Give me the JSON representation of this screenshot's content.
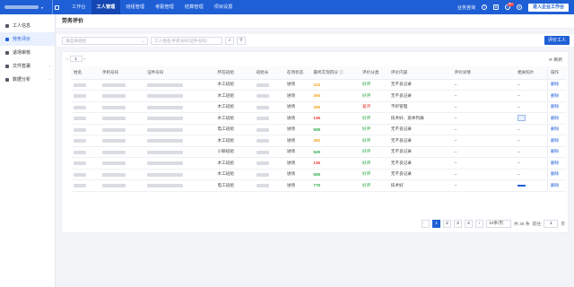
{
  "topbar": {
    "nav": [
      "工作台",
      "工人管理",
      "班组管理",
      "考勤管理",
      "结算管理",
      "项目设置"
    ],
    "active_nav": 1,
    "support": "业务咨询",
    "badge": "99+",
    "enter_button": "进入企业工作台"
  },
  "sidebar": {
    "items": [
      {
        "label": "工人信息",
        "active": false,
        "arrow": ""
      },
      {
        "label": "劳务评价",
        "active": true,
        "arrow": ""
      },
      {
        "label": "退场审核",
        "active": false,
        "arrow": ""
      },
      {
        "label": "文件签署",
        "active": false,
        "arrow": "›"
      },
      {
        "label": "数据分析",
        "active": false,
        "arrow": "›"
      }
    ]
  },
  "page": {
    "title": "劳务评价",
    "filter": {
      "team_placeholder": "请选择班组",
      "search_placeholder": "工人姓名/手机号码/证件号码/",
      "search_icon": "⌕",
      "filter_icon": "⚲",
      "eval_button": "评价工人"
    },
    "mini_pager": {
      "prev": "‹",
      "page": "1",
      "next": "›"
    },
    "refresh": "⟳ 刷新"
  },
  "table": {
    "headers": [
      "姓名",
      "手机号码",
      "证件号码",
      "所在班组",
      "班组长",
      "在场状态",
      "最终实现得分 ⓘ",
      "评价分类",
      "评价内容",
      "评价详情",
      "相关照片",
      "操作"
    ],
    "rows": [
      {
        "team": "木工班组",
        "status": "进场",
        "score": "415",
        "score_color": "#f5a623",
        "level": "好评",
        "content": "无不良记录",
        "detail": "--",
        "photo": "--",
        "op": "删除"
      },
      {
        "team": "木工班组",
        "status": "进场",
        "score": "365",
        "score_color": "#f5a623",
        "level": "好评",
        "content": "无不良记录",
        "detail": "--",
        "photo": "--",
        "op": "删除"
      },
      {
        "team": "木工班组",
        "status": "进场",
        "score": "395",
        "score_color": "#f5a623",
        "level": "差评",
        "content": "不听管理",
        "detail": "--",
        "photo": "--",
        "op": "删除"
      },
      {
        "team": "木工班组",
        "status": "进场",
        "score": "136",
        "score_color": "#e53935",
        "level": "好评",
        "content": "技术好、爱休列痛",
        "detail": "--",
        "photo": "thumb",
        "op": "删除"
      },
      {
        "team": "电工班组",
        "status": "进场",
        "score": "505",
        "score_color": "#28a745",
        "level": "好评",
        "content": "无不良记录",
        "detail": "--",
        "photo": "--",
        "op": "删除"
      },
      {
        "team": "木工班组",
        "status": "进场",
        "score": "365",
        "score_color": "#f5a623",
        "level": "好评",
        "content": "无不良记录",
        "detail": "--",
        "photo": "--",
        "op": "删除"
      },
      {
        "team": "小颖班组",
        "status": "进场",
        "score": "530",
        "score_color": "#28a745",
        "level": "好评",
        "content": "无不良记录",
        "detail": "--",
        "photo": "--",
        "op": "删除"
      },
      {
        "team": "木工班组",
        "status": "进场",
        "score": "136",
        "score_color": "#e53935",
        "level": "好评",
        "content": "无不良记录",
        "detail": "--",
        "photo": "--",
        "op": "删除"
      },
      {
        "team": "木工班组",
        "status": "进场",
        "score": "505",
        "score_color": "#28a745",
        "level": "好评",
        "content": "无不良记录",
        "detail": "--",
        "photo": "--",
        "op": "删除"
      },
      {
        "team": "电工班组",
        "status": "进场",
        "score": "770",
        "score_color": "#28a745",
        "level": "好评",
        "content": "技术好",
        "detail": "--",
        "photo": "line",
        "op": "删除"
      }
    ]
  },
  "pagination": {
    "prev": "‹",
    "pages": [
      "1",
      "2",
      "3",
      "4"
    ],
    "active": 0,
    "next": "›",
    "page_size": "10条/页",
    "total": "共 35 条",
    "goto_label": "前往",
    "goto_value": "1",
    "goto_suffix": "页"
  }
}
